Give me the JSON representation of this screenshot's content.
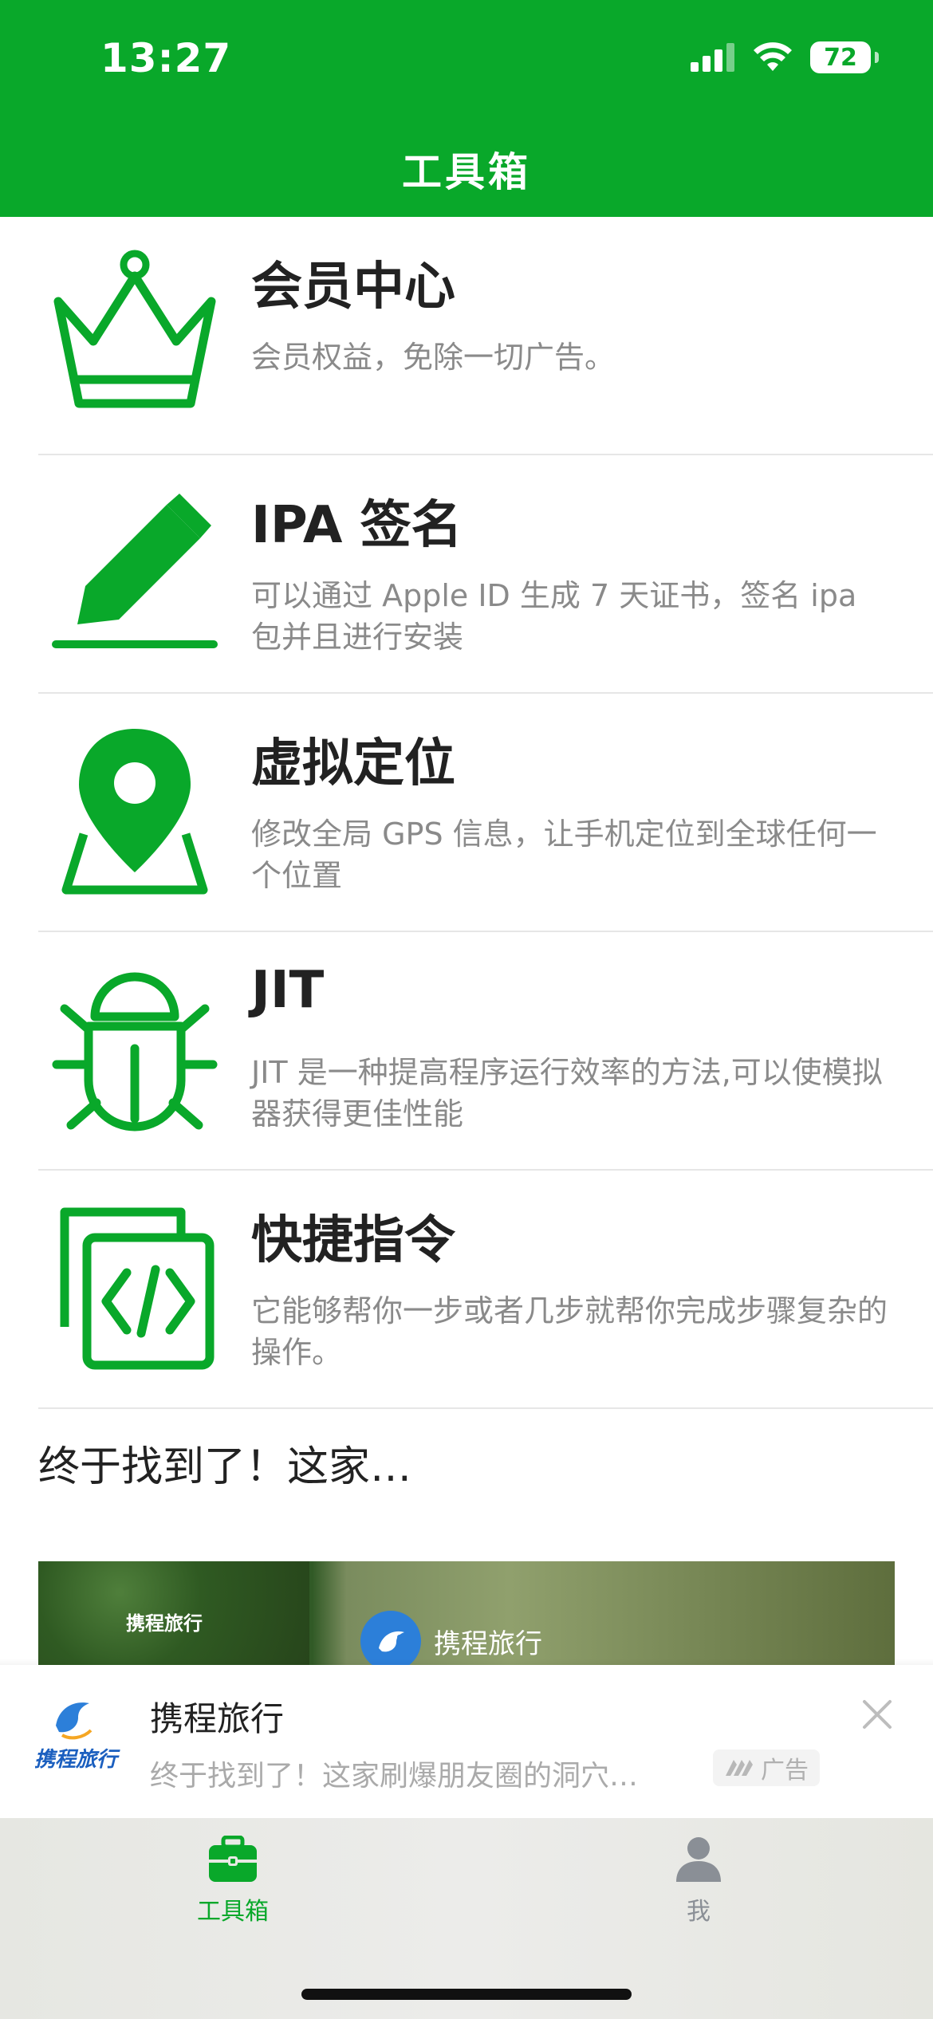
{
  "status_bar": {
    "time": "13:27",
    "battery": "72"
  },
  "header": {
    "title": "工具箱"
  },
  "tools": [
    {
      "icon": "crown-icon",
      "title": "会员中心",
      "desc": "会员权益，免除一切广告。"
    },
    {
      "icon": "pencil-icon",
      "title": "IPA 签名",
      "desc": "可以通过 Apple ID 生成 7 天证书，签名 ipa 包并且进行安装"
    },
    {
      "icon": "location-pin-icon",
      "title": "虚拟定位",
      "desc": "修改全局 GPS 信息，让手机定位到全球任何一个位置"
    },
    {
      "icon": "bug-icon",
      "title": "JIT",
      "desc": "JIT 是一种提高程序运行效率的方法,可以使模拟器获得更佳性能"
    },
    {
      "icon": "code-shortcut-icon",
      "title": "快捷指令",
      "desc": "它能够帮你一步或者几步就帮你完成步骤复杂的操作。"
    }
  ],
  "ad": {
    "caption": "终于找到了！这家…",
    "image_brand": "携程旅行",
    "mini_brand": "携程旅行",
    "banner_title": "携程旅行",
    "banner_desc": "终于找到了！这家刷爆朋友圈的洞穴…",
    "logo_text": "携程旅行",
    "tag": "广告"
  },
  "tabbar": {
    "tools_label": "工具箱",
    "me_label": "我"
  },
  "colors": {
    "brand_green": "#09A82A",
    "text_dark": "#222222",
    "text_gray": "#8a8a8a"
  }
}
